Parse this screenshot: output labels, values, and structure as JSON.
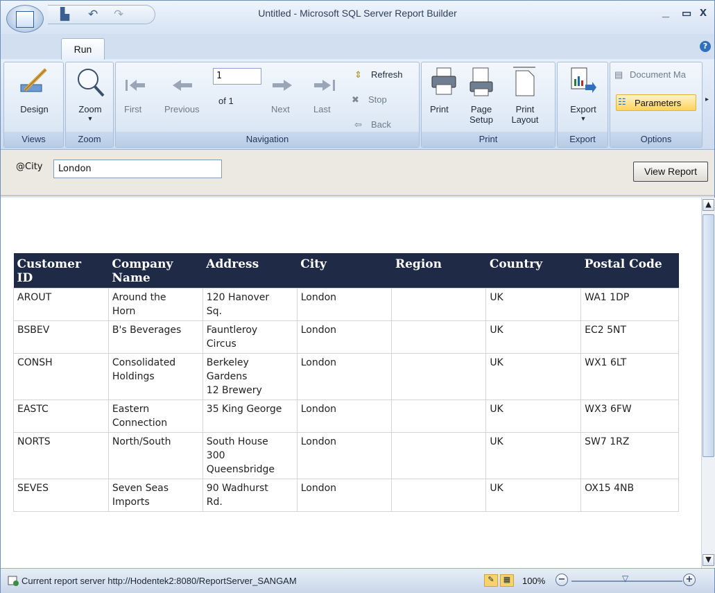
{
  "window": {
    "title": "Untitled - Microsoft SQL Server Report Builder",
    "minimize": "_",
    "restore": "▭",
    "close": "x"
  },
  "qat": {
    "save": "▙",
    "undo": "↶",
    "redo": "↷"
  },
  "tabs": {
    "run": "Run",
    "help": "?"
  },
  "ribbon": {
    "views": {
      "design": "Design",
      "group": "Views"
    },
    "zoom": {
      "zoom": "Zoom",
      "group": "Zoom"
    },
    "navigation": {
      "first": "First",
      "previous": "Previous",
      "page_value": "1",
      "of_label": "of 1",
      "next": "Next",
      "last": "Last",
      "refresh": "Refresh",
      "stop": "Stop",
      "back": "Back",
      "group": "Navigation"
    },
    "print": {
      "print": "Print",
      "page_setup_1": "Page",
      "page_setup_2": "Setup",
      "print_layout_1": "Print",
      "print_layout_2": "Layout",
      "group": "Print"
    },
    "export": {
      "export": "Export",
      "group": "Export"
    },
    "options": {
      "document_map": "Document Ma",
      "parameters": "Parameters",
      "group": "Options"
    }
  },
  "params": {
    "label": "@City",
    "value": "London",
    "view_report": "View Report"
  },
  "table": {
    "headers": [
      [
        "Customer",
        "ID"
      ],
      [
        "Company",
        "Name"
      ],
      [
        "Address",
        ""
      ],
      [
        "City",
        ""
      ],
      [
        "Region",
        ""
      ],
      [
        "Country",
        ""
      ],
      [
        "Postal Code",
        ""
      ]
    ],
    "rows": [
      [
        [
          "AROUT"
        ],
        [
          "Around the",
          "Horn"
        ],
        [
          "120 Hanover",
          "Sq."
        ],
        [
          "London"
        ],
        [
          ""
        ],
        [
          "UK"
        ],
        [
          "WA1 1DP"
        ]
      ],
      [
        [
          "BSBEV"
        ],
        [
          "B's Beverages"
        ],
        [
          "Fauntleroy",
          "Circus"
        ],
        [
          "London"
        ],
        [
          ""
        ],
        [
          "UK"
        ],
        [
          "EC2 5NT"
        ]
      ],
      [
        [
          "CONSH"
        ],
        [
          "Consolidated",
          "Holdings"
        ],
        [
          "Berkeley",
          "Gardens",
          "12  Brewery"
        ],
        [
          "London"
        ],
        [
          ""
        ],
        [
          "UK"
        ],
        [
          "WX1 6LT"
        ]
      ],
      [
        [
          "EASTC"
        ],
        [
          "Eastern",
          "Connection"
        ],
        [
          "35 King George"
        ],
        [
          "London"
        ],
        [
          ""
        ],
        [
          "UK"
        ],
        [
          "WX3 6FW"
        ]
      ],
      [
        [
          "NORTS"
        ],
        [
          "North/South"
        ],
        [
          "South House",
          "300",
          "Queensbridge"
        ],
        [
          "London"
        ],
        [
          ""
        ],
        [
          "UK"
        ],
        [
          "SW7 1RZ"
        ]
      ],
      [
        [
          "SEVES"
        ],
        [
          "Seven Seas",
          "Imports"
        ],
        [
          "90 Wadhurst",
          "Rd."
        ],
        [
          "London"
        ],
        [
          ""
        ],
        [
          "UK"
        ],
        [
          "OX15 4NB"
        ]
      ]
    ]
  },
  "status": {
    "server_text": "Current report server http://Hodentek2:8080/ReportServer_SANGAM",
    "zoom": "100%",
    "zoom_out": "−",
    "zoom_in": "+"
  },
  "colors": {
    "header_bg": "#1f2a46",
    "accent": "#ffd35a"
  }
}
